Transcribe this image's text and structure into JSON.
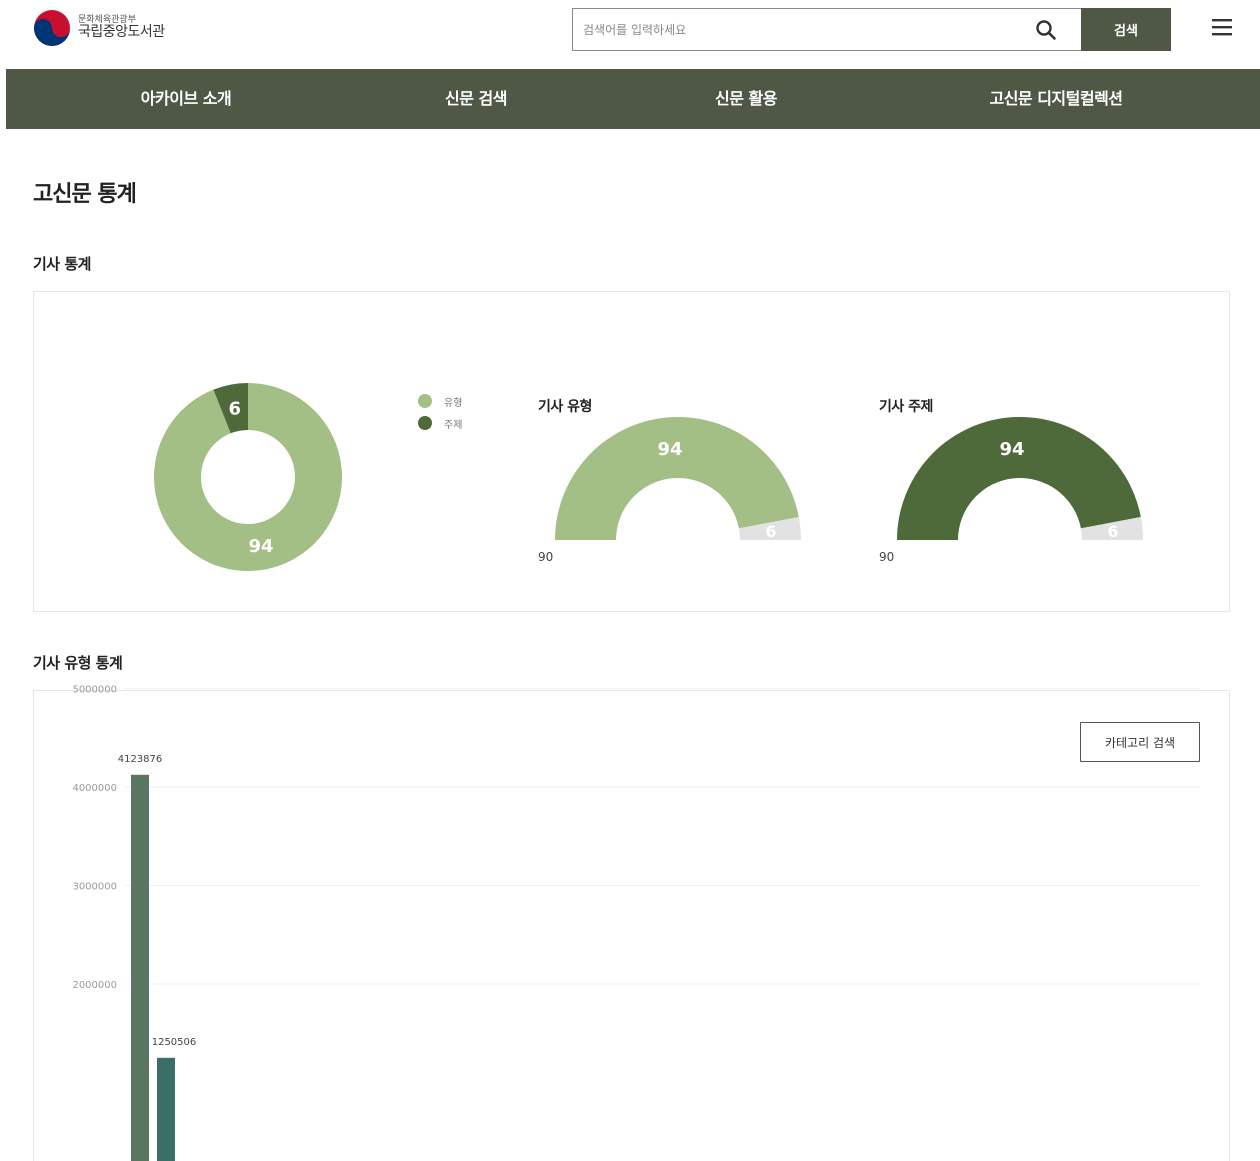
{
  "header": {
    "ministry": "문화체육관광부",
    "library_name": "국립중앙도서관",
    "search_placeholder": "검색어를 입력하세요",
    "search_button": "검색"
  },
  "nav": {
    "items": [
      {
        "label": "아카이브 소개"
      },
      {
        "label": "신문 검색"
      },
      {
        "label": "신문 활용"
      },
      {
        "label": "고신문 디지털컬렉션"
      }
    ]
  },
  "page": {
    "title": "고신문 통계",
    "article_stats_title": "기사 통계",
    "type_stats_title": "기사 유형 통계",
    "category_button": "카테고리 검색"
  },
  "colors": {
    "nav_bg": "#4f5745",
    "light_green": "#a3bf85",
    "dark_green": "#4e6a3b",
    "bar_green": "#5b7660",
    "bar_teal": "#3b6e66",
    "gauge_rest": "#e2e2e2"
  },
  "chart_data": [
    {
      "type": "pie",
      "variant": "donut",
      "labels": [
        "유형",
        "주제"
      ],
      "values": [
        94,
        6
      ],
      "legend": "right"
    },
    {
      "type": "pie",
      "variant": "half-gauge",
      "title": "기사 유형",
      "value": 94,
      "rest": 6,
      "min_label": "90"
    },
    {
      "type": "pie",
      "variant": "half-gauge",
      "title": "기사 주제",
      "value": 94,
      "rest": 6,
      "min_label": "90"
    },
    {
      "type": "bar",
      "values": [
        4123876,
        1250506
      ],
      "value_labels": [
        "4123876",
        "1250506"
      ],
      "y_ticks": [
        "5000000",
        "4000000",
        "3000000",
        "2000000"
      ],
      "ylim": [
        0,
        5000000
      ],
      "grid": true
    }
  ]
}
